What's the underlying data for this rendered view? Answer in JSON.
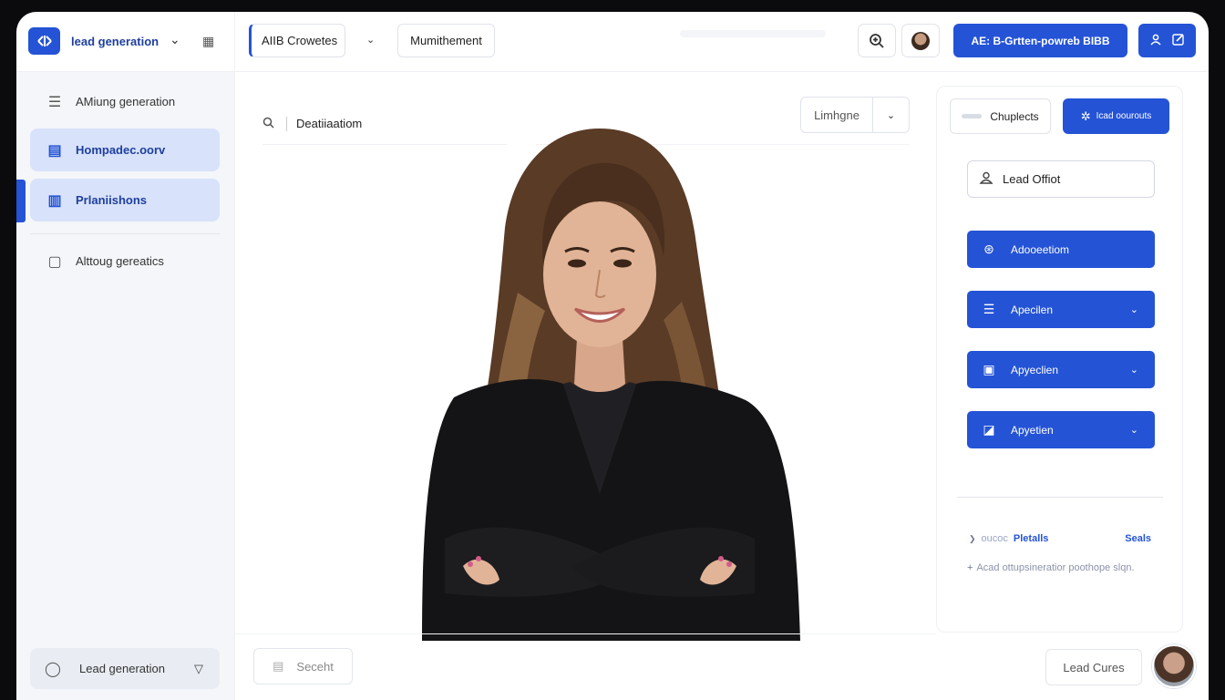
{
  "header": {
    "brand_label": "lead generation",
    "tab_active": "AIIB Crowetes",
    "tab_secondary": "Mumithement",
    "primary_button": "AE: B-Grtten-powreb BIBB",
    "icons": [
      "logo-icon",
      "chevron-down-icon",
      "grid-icon",
      "zoom-icon",
      "user-icon",
      "edit-icon"
    ]
  },
  "sidebar": {
    "items": [
      {
        "label": "AMiung generation",
        "icon": "list-icon"
      },
      {
        "label": "Hompadec.oorv",
        "icon": "building-icon"
      },
      {
        "label": "Prlaniishons",
        "icon": "building-icon"
      },
      {
        "label": "Alttoug gereatics",
        "icon": "document-icon"
      }
    ],
    "footer_label": "Lead generation"
  },
  "main": {
    "search_label": "Deatiiaatiom",
    "filter_label": "Limhgne",
    "select_label": "Seceht"
  },
  "panel": {
    "tab_outline": "Chuplects",
    "tab_filled": "Icad oourouts",
    "lead_label": "Lead Offiot",
    "rows": [
      {
        "label": "Adooeetiom",
        "icon": "gear-icon",
        "has_chevron": false
      },
      {
        "label": "Apecilen",
        "icon": "list-icon",
        "has_chevron": true
      },
      {
        "label": "Apyeclien",
        "icon": "image-icon",
        "has_chevron": true
      },
      {
        "label": "Apyetien",
        "icon": "chart-icon",
        "has_chevron": true
      }
    ],
    "meta_left": "oucoc",
    "meta_mid": "Pletalls",
    "meta_right": "Seals",
    "note": "Acad ottupsineratior poothope slqn.",
    "cta_label": "Lead Cures"
  },
  "colors": {
    "accent": "#2453d6",
    "sidebar_bg": "#f4f6f9",
    "active_item_bg": "#d8e2fa",
    "frame_bg": "#0b0b0d"
  }
}
